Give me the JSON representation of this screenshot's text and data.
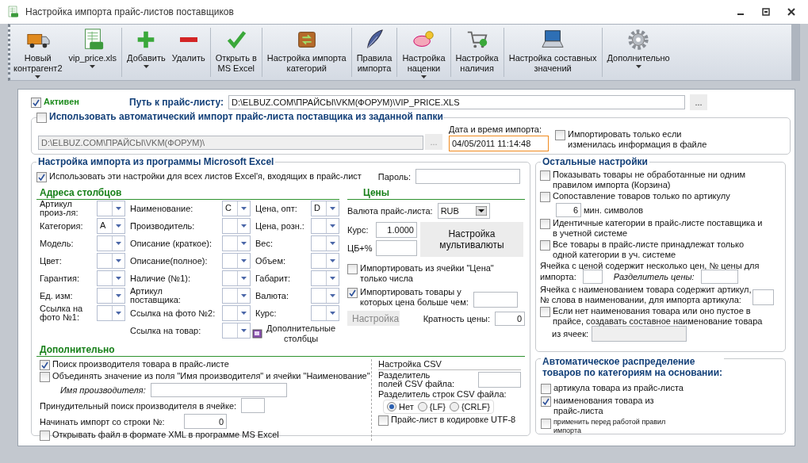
{
  "window": {
    "title": "Настройка импорта прайс-листов поставщиков"
  },
  "toolbar": [
    {
      "kind": "truck",
      "label": "Новый\nконтрагент2",
      "dropdown": true,
      "separator_before": false
    },
    {
      "kind": "spreadsheet",
      "label": "vip_price.xls",
      "dropdown": true,
      "separator_before": false
    },
    {
      "kind": "plus",
      "label": "Добавить",
      "dropdown": true,
      "separator_before": true
    },
    {
      "kind": "minus",
      "label": "Удалить",
      "dropdown": false,
      "separator_before": false
    },
    {
      "kind": "check",
      "label": "Открыть в\nMS Excel",
      "dropdown": false,
      "separator_before": true
    },
    {
      "kind": "box",
      "label": "Настройка импорта\nкатегорий",
      "dropdown": false,
      "separator_before": true
    },
    {
      "kind": "feather",
      "label": "Правила\nимпорта",
      "dropdown": false,
      "separator_before": true
    },
    {
      "kind": "piggy",
      "label": "Настройка\nнаценки",
      "dropdown": true,
      "separator_before": true
    },
    {
      "kind": "cart",
      "label": "Настройка\nналичия",
      "dropdown": false,
      "separator_before": true
    },
    {
      "kind": "laptop",
      "label": "Настройка составных\nзначений",
      "dropdown": false,
      "separator_before": true
    },
    {
      "kind": "gear",
      "label": "Дополнительно",
      "dropdown": true,
      "separator_before": true
    }
  ],
  "active": {
    "label": "Активен",
    "checked": true
  },
  "path": {
    "label": "Путь к прайс-листу:",
    "value": "D:\\ELBUZ.COM\\ПРАЙСЫ\\VKM(ФОРУМ)\\VIP_PRICE.XLS",
    "browse": "..."
  },
  "auto_import": {
    "label": "Использовать автоматический импорт прайс-листа поставщика из заданной папки",
    "checked": false,
    "folder": "D:\\ELBUZ.COM\\ПРАЙСЫ\\VKM(ФОРУМ)\\",
    "disabled": true,
    "browse": "...",
    "datetime_label": "Дата и время импорта:",
    "datetime": "04/05/2011 11:14:48",
    "datetime_focused": true,
    "only_changed": {
      "label": "Импортировать только если\nизменилась информация в файле",
      "checked": false
    }
  },
  "excel": {
    "title": "Настройка импорта из программы Microsoft Excel",
    "all_sheets": {
      "label": "Использовать эти настройки для всех листов Excel'я, входящих в прайс-лист",
      "checked": true
    },
    "password_label": "Пароль:",
    "columns_title": "Адреса столбцов",
    "column_groups": [
      {
        "fields": [
          {
            "label": "Артикул\nпроиз-ля:"
          },
          {
            "label": "Категория:",
            "value": "A"
          },
          {
            "label": "Модель:"
          },
          {
            "label": "Цвет:"
          },
          {
            "label": "Гарантия:"
          },
          {
            "label": "Ед. изм:"
          },
          {
            "label": "Ссылка на\nфото №1:"
          }
        ]
      },
      {
        "fields": [
          {
            "label": "Наименование:",
            "value": "C"
          },
          {
            "label": "Производитель:"
          },
          {
            "label": "Описание (краткое):"
          },
          {
            "label": "Описание(полное):"
          },
          {
            "label": "Наличие (№1):"
          },
          {
            "label": "Артикул\nпоставщика:"
          },
          {
            "label": "Ссылка на фото №2:"
          },
          {
            "label": "Ссылка на товар:"
          }
        ]
      },
      {
        "fields": [
          {
            "label": "Цена, опт:",
            "value": "D"
          },
          {
            "label": "Цена, розн.:"
          },
          {
            "label": "Вес:"
          },
          {
            "label": "Объем:"
          },
          {
            "label": "Габарит:"
          },
          {
            "label": "Валюта:"
          },
          {
            "label": "Курс:"
          }
        ]
      }
    ],
    "extra_columns": "Дополнительные\nстолбцы",
    "prices": {
      "title": "Цены",
      "currency_label": "Валюта прайс-листа:",
      "currency": "RUB",
      "rate_label": "Курс:",
      "rate": "1.0000",
      "cb_label": "ЦБ+%",
      "multicurrency": "Настройка\nмультивалюты",
      "only_numbers": {
        "label": "Импортировать из ячейки \"Цена\"\nтолько числа",
        "checked": false
      },
      "price_greater": {
        "label": "Импортировать товары у\nкоторых цена больше чем:",
        "checked": true
      },
      "settings": {
        "label": "Настройка",
        "disabled": true
      },
      "multiplicity_label": "Кратность цены:",
      "multiplicity": "0"
    },
    "extra": {
      "title": "Дополнительно",
      "search_manufacturer": {
        "label": "Поиск производителя товара в прайс-листе",
        "checked": true
      },
      "merge": {
        "label": "Объединять значение из поля \"Имя производителя\" и ячейки \"Наименование\"",
        "checked": false
      },
      "manufacturer_name_label": "Имя производителя:",
      "forced_search_label": "Принудительный поиск производителя в ячейке:",
      "start_row_label": "Начинать импорт со строки №:",
      "start_row": "0",
      "open_xml": {
        "label": "Открывать файл в формате XML в программе MS Excel",
        "checked": false
      }
    },
    "csv": {
      "title": "Настройка CSV",
      "field_sep_label": "Разделитель\nполей CSV файла:",
      "row_sep_label": "Разделитель строк CSV файла:",
      "row_seps": [
        {
          "label": "Нет",
          "selected": true
        },
        {
          "label": "{LF}",
          "selected": false
        },
        {
          "label": "{CRLF}",
          "selected": false
        }
      ],
      "utf8": {
        "label": "Прайс-лист в кодировке UTF-8",
        "checked": false
      }
    }
  },
  "other": {
    "title": "Остальные настройки",
    "show_unprocessed": {
      "label": "Показывать товары не обработанные ни одним\nправилом импорта (Корзина)",
      "checked": false
    },
    "article_only": {
      "label": "Сопоставление товаров только по артикулу",
      "checked": false
    },
    "min_chars": "6",
    "min_chars_label": "мин. символов",
    "identical_categories": {
      "label": "Идентичные категории в прайс-листе поставщика и\nв учетной системе",
      "checked": false
    },
    "single_category": {
      "label": "Все товары в прайс-листе принадлежат только\nодной категории в уч. системе",
      "checked": false
    },
    "price_index_label": "Ячейка с ценой содержит несколько цен, № цены для",
    "price_index_label_end": "импорта:",
    "price_sep_label": "Разделитель цены:",
    "article_word_label": "Ячейка с наименованием товара содержит артикул,\n№ слова в наименовании, для импорта артикула:",
    "compose_name": {
      "label": "Если нет наименования товара или оно пустое в\nпрайсе, создавать составное наименование товара",
      "checked": false
    },
    "compose_name_end": "из ячеек:"
  },
  "auto_distribution": {
    "title": "Автоматическое распределение\nтоваров по категориям на основании:",
    "options": [
      {
        "label": "артикула товара из прайс-листа",
        "checked": false,
        "small": false
      },
      {
        "label": "наименования товара из\nпрайс-листа",
        "checked": true,
        "small": false
      },
      {
        "label": "применить перед работой правил\nимпорта",
        "checked": false,
        "small": true
      }
    ]
  }
}
